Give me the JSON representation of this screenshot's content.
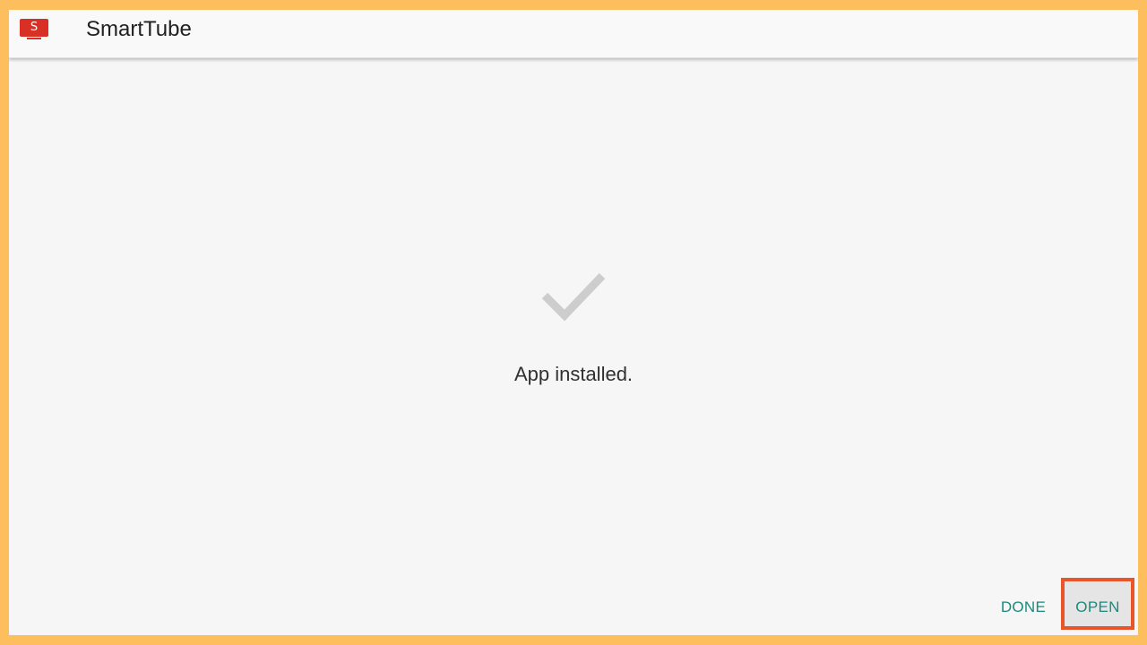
{
  "header": {
    "app_icon_glyph": "S",
    "app_name": "SmartTube"
  },
  "main": {
    "icon": "checkmark-icon",
    "status_text": "App installed."
  },
  "actions": {
    "done_label": "DONE",
    "open_label": "OPEN"
  },
  "colors": {
    "outer_border": "#FDBF5E",
    "background": "#F6F6F6",
    "accent": "#1A8A7E",
    "brand_red": "#D93025",
    "highlight": "#E8552A",
    "check": "#CDCDCD"
  }
}
